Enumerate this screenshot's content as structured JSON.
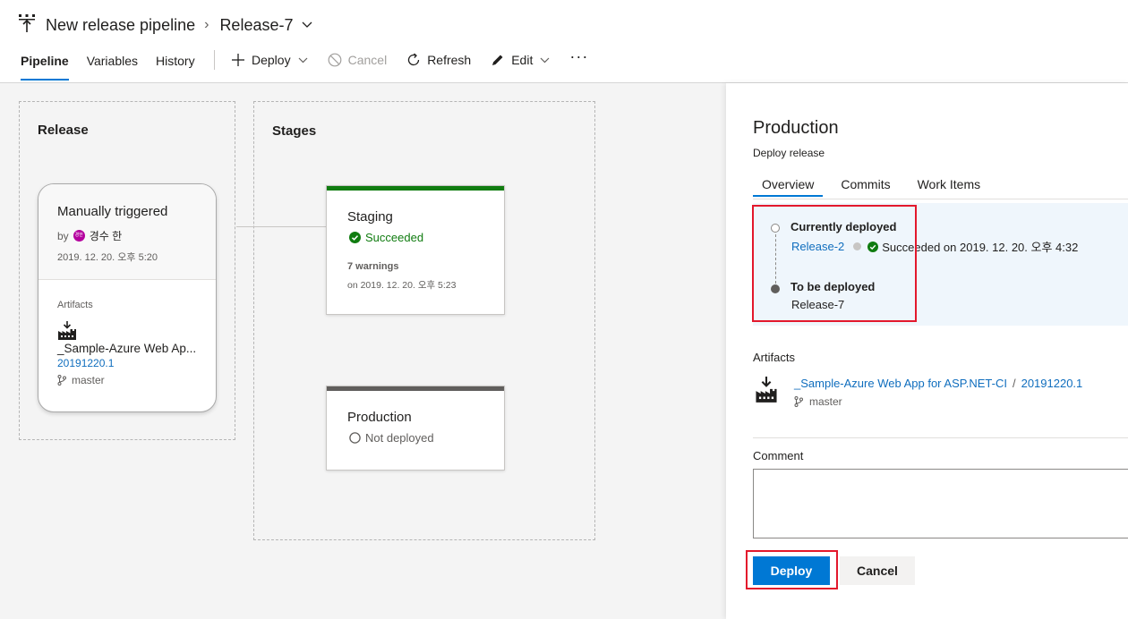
{
  "header": {
    "pipeline_name": "New release pipeline",
    "release_name": "Release-7",
    "tabs": [
      {
        "label": "Pipeline",
        "active": true
      },
      {
        "label": "Variables",
        "active": false
      },
      {
        "label": "History",
        "active": false
      }
    ],
    "toolbar": {
      "deploy_label": "Deploy",
      "cancel_label": "Cancel",
      "refresh_label": "Refresh",
      "edit_label": "Edit",
      "more_label": "···"
    }
  },
  "canvas": {
    "release_title": "Release",
    "stages_title": "Stages",
    "release_card": {
      "trigger": "Manually triggered",
      "by_prefix": "by",
      "avatar_initials": "경한",
      "user": "경수 한",
      "timestamp": "2019. 12. 20. 오후 5:20",
      "artifacts_label": "Artifacts",
      "artifact_name": "_Sample-Azure Web Ap...",
      "artifact_version": "20191220.1",
      "branch": "master"
    },
    "stages": [
      {
        "name": "Staging",
        "status": "Succeeded",
        "warnings": "7 warnings",
        "on": "on 2019. 12. 20. 오후 5:23",
        "bar_color": "#107c10",
        "status_color": "#107c10"
      },
      {
        "name": "Production",
        "status": "Not deployed",
        "bar_color": "#605e5c",
        "status_color": "#605e5c"
      }
    ]
  },
  "panel": {
    "title": "Production",
    "subtitle": "Deploy release",
    "tabs": [
      {
        "label": "Overview",
        "active": true
      },
      {
        "label": "Commits",
        "active": false
      },
      {
        "label": "Work Items",
        "active": false
      }
    ],
    "currently_deployed_label": "Currently deployed",
    "current_release": "Release-2",
    "current_status": "Succeeded on 2019. 12. 20. 오후 4:32",
    "to_be_deployed_label": "To be deployed",
    "to_be_deployed": "Release-7",
    "artifacts_label": "Artifacts",
    "artifact_name": "_Sample-Azure Web App for ASP.NET-CI",
    "artifact_separator": "/",
    "artifact_version": "20191220.1",
    "branch": "master",
    "comment_label": "Comment",
    "comment_value": "",
    "deploy_button": "Deploy",
    "cancel_button": "Cancel"
  },
  "colors": {
    "accent": "#0078d4",
    "link": "#106ebe",
    "success": "#107c10",
    "highlight_border": "#e3182c"
  }
}
